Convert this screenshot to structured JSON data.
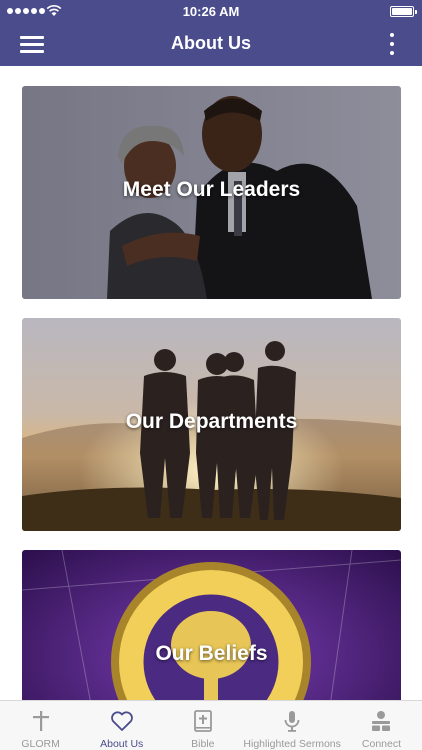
{
  "status_bar": {
    "time": "10:26 AM"
  },
  "nav": {
    "title": "About Us"
  },
  "cards": [
    {
      "label": "Meet Our Leaders"
    },
    {
      "label": "Our Departments"
    },
    {
      "label": "Our Beliefs"
    }
  ],
  "tabs": [
    {
      "label": "GLORM",
      "icon": "cross-icon",
      "active": false
    },
    {
      "label": "About Us",
      "icon": "heart-icon",
      "active": true
    },
    {
      "label": "Bible",
      "icon": "bible-icon",
      "active": false
    },
    {
      "label": "Highlighted Sermons",
      "icon": "microphone-icon",
      "active": false
    },
    {
      "label": "Connect",
      "icon": "connect-icon",
      "active": false
    }
  ],
  "colors": {
    "brand": "#4b4c8c",
    "tab_inactive": "#9a9a9a",
    "tab_bar_bg": "#f7f7f7"
  }
}
